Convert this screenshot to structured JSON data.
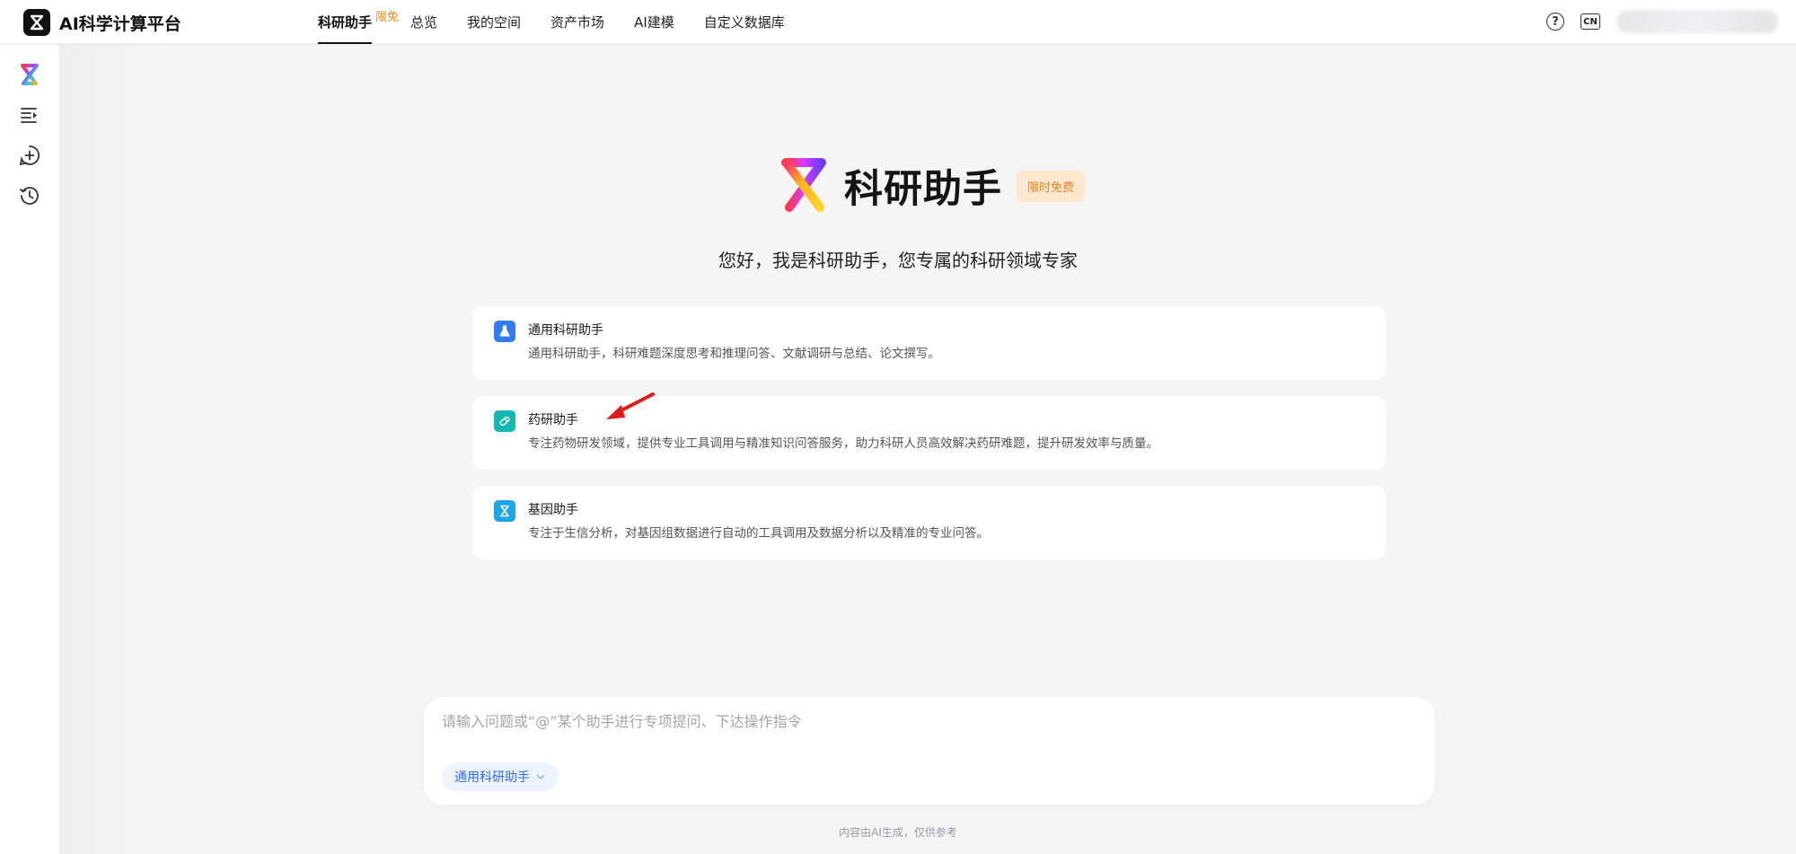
{
  "app": {
    "brand_name": "AI科学计算平台"
  },
  "nav": {
    "items": [
      {
        "label": "科研助手",
        "badge": "限免",
        "active": true
      },
      {
        "label": "总览"
      },
      {
        "label": "我的空间"
      },
      {
        "label": "资产市场"
      },
      {
        "label": "AI建模"
      },
      {
        "label": "自定义数据库"
      }
    ]
  },
  "topright": {
    "help_icon": "question-circle-icon",
    "lang_label": "CN"
  },
  "sidebar": {
    "icons": [
      "assistant-logo-icon",
      "menu-expand-icon",
      "new-chat-icon",
      "history-icon"
    ]
  },
  "hero": {
    "title": "科研助手",
    "badge": "限时免费",
    "subtitle": "您好，我是科研助手，您专属的科研领域专家"
  },
  "cards": [
    {
      "title": "通用科研助手",
      "desc": "通用科研助手，科研难题深度思考和推理问答、文献调研与总结、论文撰写。",
      "icon": "flask-icon",
      "color": "#2f7cf6"
    },
    {
      "title": "药研助手",
      "desc": "专注药物研发领域，提供专业工具调用与精准知识问答服务，助力科研人员高效解决药研难题，提升研发效率与质量。",
      "icon": "pill-icon",
      "color": "#14b8b0"
    },
    {
      "title": "基因助手",
      "desc": "专注于生信分析，对基因组数据进行自动的工具调用及数据分析以及精准的专业问答。",
      "icon": "dna-icon",
      "color": "#1aa6e8"
    }
  ],
  "composer": {
    "placeholder": "请输入问题或“@”某个助手进行专项提问、下达操作指令",
    "value": "",
    "assistant_selector": "通用科研助手"
  },
  "footnote": "内容由AI生成，仅供参考",
  "colors": {
    "accent": "#2a6df4",
    "badge_orange": "#e8821f",
    "annotation_arrow": "#e3191c"
  }
}
